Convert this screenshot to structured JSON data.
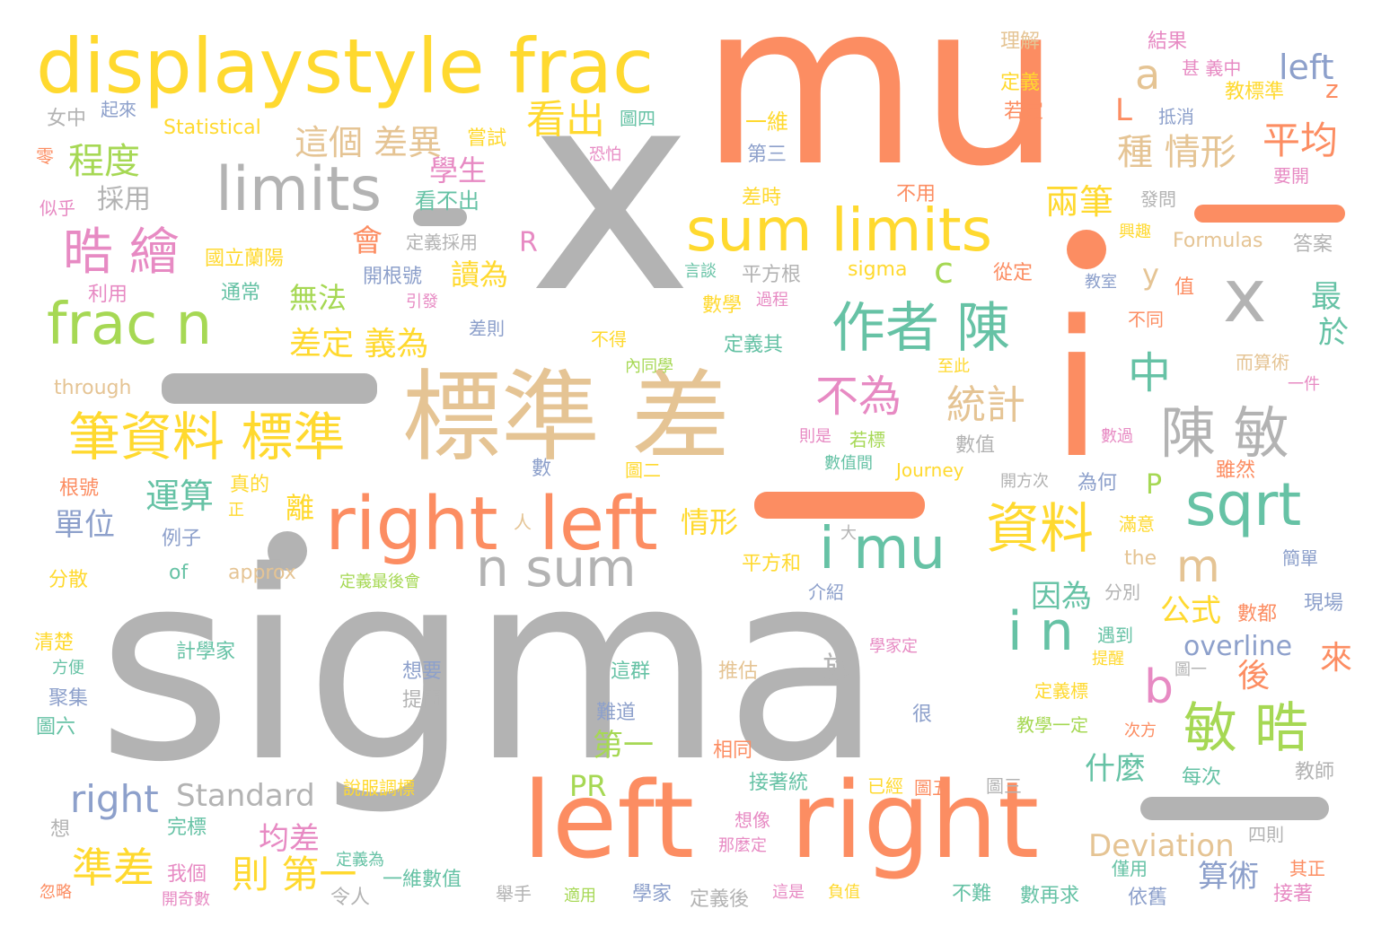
{
  "palette": {
    "gray": "#b3b3b3",
    "orange": "#fc8d62",
    "yellow": "#ffd92f",
    "tan": "#e5c494",
    "green": "#a6d854",
    "teal": "#66c2a5",
    "pink": "#e78ac3",
    "blue": "#8da0cb"
  },
  "words": [
    {
      "text": "sigma",
      "color": "gray"
    },
    {
      "text": "mu",
      "color": "orange"
    },
    {
      "text": "x",
      "color": "gray"
    },
    {
      "text": "i",
      "color": "orange"
    },
    {
      "text": "displaystyle frac",
      "color": "yellow"
    },
    {
      "text": "標準 差",
      "color": "tan"
    },
    {
      "text": "left",
      "color": "orange"
    },
    {
      "text": "right",
      "color": "orange"
    },
    {
      "text": "right",
      "color": "orange"
    },
    {
      "text": "left",
      "color": "orange"
    },
    {
      "text": "limits",
      "color": "gray"
    },
    {
      "text": "sum limits",
      "color": "yellow"
    },
    {
      "text": "frac n",
      "color": "green"
    },
    {
      "text": "i mu",
      "color": "teal"
    },
    {
      "text": "n sum",
      "color": "gray"
    },
    {
      "text": "sqrt",
      "color": "teal"
    },
    {
      "text": "x",
      "color": "gray"
    },
    {
      "text": "作者 陳",
      "color": "teal"
    },
    {
      "text": "陳 敏",
      "color": "gray"
    },
    {
      "text": "筆資料 標準",
      "color": "yellow"
    },
    {
      "text": "資料",
      "color": "yellow"
    },
    {
      "text": "敏 晧",
      "color": "green"
    },
    {
      "text": "晧 繪",
      "color": "pink"
    },
    {
      "text": "i n",
      "color": "teal"
    },
    {
      "text": "看出",
      "color": "yellow"
    },
    {
      "text": "這個 差異",
      "color": "tan"
    },
    {
      "text": "程度",
      "color": "green"
    },
    {
      "text": "兩筆",
      "color": "yellow"
    },
    {
      "text": "種 情形",
      "color": "tan"
    },
    {
      "text": "平均",
      "color": "orange"
    },
    {
      "text": "a",
      "color": "tan"
    },
    {
      "text": "left",
      "color": "blue"
    },
    {
      "text": "中",
      "color": "teal"
    },
    {
      "text": "統計",
      "color": "tan"
    },
    {
      "text": "不為",
      "color": "pink"
    },
    {
      "text": "m",
      "color": "tan"
    },
    {
      "text": "b",
      "color": "pink"
    },
    {
      "text": "差定 義為",
      "color": "yellow"
    },
    {
      "text": "運算",
      "color": "teal"
    },
    {
      "text": "準差",
      "color": "yellow"
    },
    {
      "text": "則 第一",
      "color": "yellow"
    },
    {
      "text": "right",
      "color": "blue"
    },
    {
      "text": "Standard",
      "color": "gray"
    },
    {
      "text": "Deviation",
      "color": "tan"
    },
    {
      "text": "overline",
      "color": "blue"
    },
    {
      "text": "單位",
      "color": "blue"
    },
    {
      "text": "學生",
      "color": "pink"
    },
    {
      "text": "採用",
      "color": "gray"
    },
    {
      "text": "會",
      "color": "orange"
    },
    {
      "text": "讀為",
      "color": "yellow"
    },
    {
      "text": "無法",
      "color": "green"
    },
    {
      "text": "離",
      "color": "yellow"
    },
    {
      "text": "情形",
      "color": "yellow"
    },
    {
      "text": "因為",
      "color": "teal"
    },
    {
      "text": "公式",
      "color": "yellow"
    },
    {
      "text": "後",
      "color": "orange"
    },
    {
      "text": "來",
      "color": "orange"
    },
    {
      "text": "最",
      "color": "teal"
    },
    {
      "text": "於",
      "color": "teal"
    },
    {
      "text": "什麼",
      "color": "teal"
    },
    {
      "text": "第一",
      "color": "green"
    },
    {
      "text": "均差",
      "color": "pink"
    },
    {
      "text": "算術",
      "color": "blue"
    },
    {
      "text": "旅",
      "color": "gray"
    },
    {
      "text": "PR",
      "color": "green"
    },
    {
      "text": "c",
      "color": "green"
    },
    {
      "text": "L",
      "color": "orange"
    },
    {
      "text": "y",
      "color": "tan"
    },
    {
      "text": "R",
      "color": "pink"
    },
    {
      "text": "P",
      "color": "green"
    },
    {
      "text": "z",
      "color": "orange"
    },
    {
      "text": "理解",
      "color": "tan"
    },
    {
      "text": "結果",
      "color": "pink"
    },
    {
      "text": "甚 義中",
      "color": "pink"
    },
    {
      "text": "定義",
      "color": "yellow"
    },
    {
      "text": "若定",
      "color": "orange"
    },
    {
      "text": "教標準",
      "color": "yellow"
    },
    {
      "text": "抵消",
      "color": "blue"
    },
    {
      "text": "女中",
      "color": "gray"
    },
    {
      "text": "起來",
      "color": "blue"
    },
    {
      "text": "Statistical",
      "color": "yellow"
    },
    {
      "text": "嘗試",
      "color": "yellow"
    },
    {
      "text": "圖四",
      "color": "teal"
    },
    {
      "text": "一維",
      "color": "yellow"
    },
    {
      "text": "第三",
      "color": "blue"
    },
    {
      "text": "恐怕",
      "color": "pink"
    },
    {
      "text": "零",
      "color": "orange"
    },
    {
      "text": "似乎",
      "color": "pink"
    },
    {
      "text": "看不出",
      "color": "teal"
    },
    {
      "text": "差時",
      "color": "yellow"
    },
    {
      "text": "不用",
      "color": "orange"
    },
    {
      "text": "發問",
      "color": "gray"
    },
    {
      "text": "要開",
      "color": "pink"
    },
    {
      "text": "國立蘭陽",
      "color": "yellow"
    },
    {
      "text": "定義採用",
      "color": "gray"
    },
    {
      "text": "興趣",
      "color": "yellow"
    },
    {
      "text": "Formulas",
      "color": "tan"
    },
    {
      "text": "答案",
      "color": "gray"
    },
    {
      "text": "利用",
      "color": "pink"
    },
    {
      "text": "通常",
      "color": "teal"
    },
    {
      "text": "開根號",
      "color": "blue"
    },
    {
      "text": "言談",
      "color": "teal"
    },
    {
      "text": "平方根",
      "color": "gray"
    },
    {
      "text": "sigma",
      "color": "yellow"
    },
    {
      "text": "從定",
      "color": "orange"
    },
    {
      "text": "教室",
      "color": "blue"
    },
    {
      "text": "值",
      "color": "orange"
    },
    {
      "text": "引發",
      "color": "pink"
    },
    {
      "text": "數學",
      "color": "yellow"
    },
    {
      "text": "過程",
      "color": "pink"
    },
    {
      "text": "差則",
      "color": "blue"
    },
    {
      "text": "不同",
      "color": "orange"
    },
    {
      "text": "不得",
      "color": "yellow"
    },
    {
      "text": "定義其",
      "color": "teal"
    },
    {
      "text": "內同學",
      "color": "green"
    },
    {
      "text": "至此",
      "color": "yellow"
    },
    {
      "text": "而算術",
      "color": "tan"
    },
    {
      "text": "through",
      "color": "tan"
    },
    {
      "text": "一件",
      "color": "pink"
    },
    {
      "text": "則是",
      "color": "pink"
    },
    {
      "text": "若標",
      "color": "green"
    },
    {
      "text": "數值",
      "color": "gray"
    },
    {
      "text": "數過",
      "color": "pink"
    },
    {
      "text": "數值間",
      "color": "teal"
    },
    {
      "text": "Journey",
      "color": "yellow"
    },
    {
      "text": "開方次",
      "color": "gray"
    },
    {
      "text": "為何",
      "color": "blue"
    },
    {
      "text": "雖然",
      "color": "orange"
    },
    {
      "text": "數",
      "color": "blue"
    },
    {
      "text": "圖二",
      "color": "yellow"
    },
    {
      "text": "根號",
      "color": "orange"
    },
    {
      "text": "真的",
      "color": "yellow"
    },
    {
      "text": "正",
      "color": "yellow"
    },
    {
      "text": "人",
      "color": "tan"
    },
    {
      "text": "大",
      "color": "gray"
    },
    {
      "text": "滿意",
      "color": "yellow"
    },
    {
      "text": "例子",
      "color": "blue"
    },
    {
      "text": "of",
      "color": "teal"
    },
    {
      "text": "approx",
      "color": "tan"
    },
    {
      "text": "平方和",
      "color": "yellow"
    },
    {
      "text": "the",
      "color": "tan"
    },
    {
      "text": "簡單",
      "color": "blue"
    },
    {
      "text": "分散",
      "color": "yellow"
    },
    {
      "text": "定義最後會",
      "color": "green"
    },
    {
      "text": "介紹",
      "color": "blue"
    },
    {
      "text": "分別",
      "color": "gray"
    },
    {
      "text": "數都",
      "color": "orange"
    },
    {
      "text": "現場",
      "color": "blue"
    },
    {
      "text": "清楚",
      "color": "yellow"
    },
    {
      "text": "方便",
      "color": "teal"
    },
    {
      "text": "計學家",
      "color": "teal"
    },
    {
      "text": "學家定",
      "color": "pink"
    },
    {
      "text": "遇到",
      "color": "teal"
    },
    {
      "text": "提醒",
      "color": "yellow"
    },
    {
      "text": "圖一",
      "color": "gray"
    },
    {
      "text": "想要",
      "color": "blue"
    },
    {
      "text": "提問",
      "color": "gray"
    },
    {
      "text": "這群",
      "color": "teal"
    },
    {
      "text": "推估",
      "color": "tan"
    },
    {
      "text": "聚集",
      "color": "blue"
    },
    {
      "text": "定義標",
      "color": "yellow"
    },
    {
      "text": "圖六",
      "color": "teal"
    },
    {
      "text": "難道",
      "color": "blue"
    },
    {
      "text": "很",
      "color": "blue"
    },
    {
      "text": "教學一定",
      "color": "green"
    },
    {
      "text": "次方",
      "color": "orange"
    },
    {
      "text": "相同",
      "color": "orange"
    },
    {
      "text": "說服調標",
      "color": "yellow"
    },
    {
      "text": "接著統",
      "color": "teal"
    },
    {
      "text": "已經",
      "color": "yellow"
    },
    {
      "text": "圖五",
      "color": "orange"
    },
    {
      "text": "圖三",
      "color": "gray"
    },
    {
      "text": "每次",
      "color": "teal"
    },
    {
      "text": "教師",
      "color": "gray"
    },
    {
      "text": "完標",
      "color": "teal"
    },
    {
      "text": "想像",
      "color": "pink"
    },
    {
      "text": "想",
      "color": "gray"
    },
    {
      "text": "那麼定",
      "color": "pink"
    },
    {
      "text": "四則",
      "color": "gray"
    },
    {
      "text": "我個",
      "color": "pink"
    },
    {
      "text": "定義為",
      "color": "teal"
    },
    {
      "text": "一維數值",
      "color": "teal"
    },
    {
      "text": "僅用",
      "color": "teal"
    },
    {
      "text": "其正",
      "color": "orange"
    },
    {
      "text": "忽略",
      "color": "orange"
    },
    {
      "text": "開奇數",
      "color": "pink"
    },
    {
      "text": "令人",
      "color": "gray"
    },
    {
      "text": "舉手",
      "color": "gray"
    },
    {
      "text": "適用",
      "color": "green"
    },
    {
      "text": "學家",
      "color": "blue"
    },
    {
      "text": "定義後",
      "color": "gray"
    },
    {
      "text": "這是",
      "color": "pink"
    },
    {
      "text": "負值",
      "color": "yellow"
    },
    {
      "text": "不難",
      "color": "teal"
    },
    {
      "text": "數再求",
      "color": "teal"
    },
    {
      "text": "依舊",
      "color": "blue"
    },
    {
      "text": "接著",
      "color": "pink"
    }
  ]
}
